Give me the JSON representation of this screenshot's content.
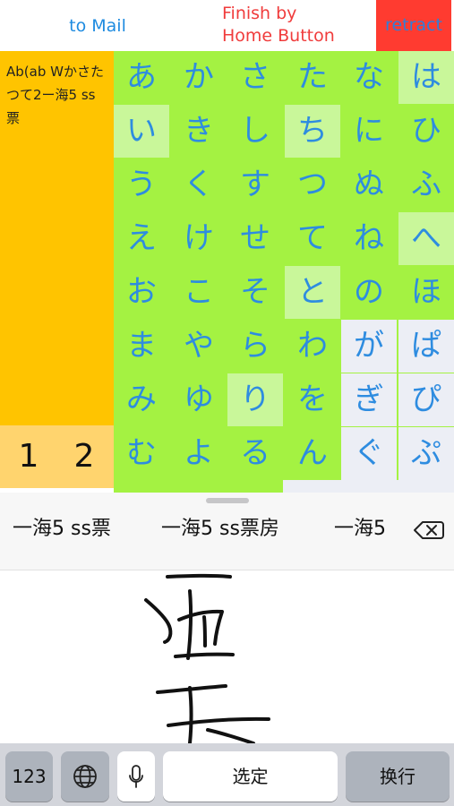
{
  "topbar": {
    "to_mail": "to Mail",
    "finish_line1": "Finish by",
    "finish_line2": "Home Button",
    "retract": "retract"
  },
  "note": {
    "text": "Ab(ab Wかさたつて2ー海5 ss票"
  },
  "numbers": {
    "one": "1",
    "two": "2"
  },
  "kana": {
    "columns": [
      [
        "あ",
        "い",
        "う",
        "え",
        "お",
        "ま",
        "み",
        "む"
      ],
      [
        "か",
        "き",
        "く",
        "け",
        "こ",
        "や",
        "ゆ",
        "よ"
      ],
      [
        "さ",
        "し",
        "す",
        "せ",
        "そ",
        "ら",
        "り",
        "る"
      ],
      [
        "た",
        "ち",
        "つ",
        "て",
        "と",
        "わ",
        "を",
        "ん"
      ],
      [
        "な",
        "に",
        "ぬ",
        "ね",
        "の",
        "が",
        "ぎ",
        "ぐ"
      ],
      [
        "は",
        "ひ",
        "ふ",
        "へ",
        "ほ",
        "ぱ",
        "ぴ",
        "ぷ"
      ]
    ]
  },
  "candidates": [
    "一海5 ss票",
    "一海5 ss票房",
    "一海5"
  ],
  "keyboard": {
    "numbers_key": "123",
    "space_key": "选定",
    "return_key": "换行"
  },
  "colors": {
    "accent_blue": "#2e8ce0",
    "grid_green": "#a4f242",
    "note_yellow": "#ffc400",
    "retract_red": "#ff3b30"
  },
  "icons": {
    "globe": "globe-icon",
    "microphone": "microphone-icon",
    "backspace": "backspace-icon"
  }
}
